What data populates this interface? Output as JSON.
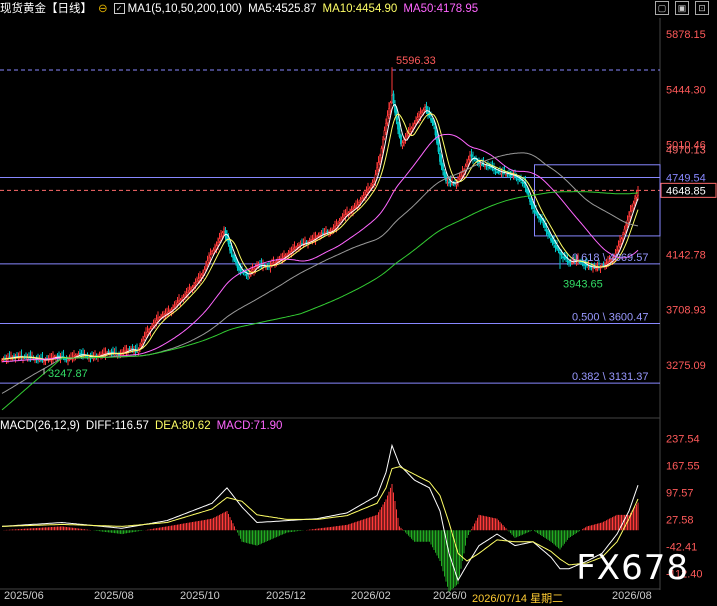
{
  "header": {
    "symbol": "现货黄金",
    "period": "【日线】",
    "icon": "circle-minus-icon",
    "ma_title": "MA1(5,10,50,200,100)",
    "ma5": "MA5:4525.87",
    "ma10": "MA10:4454.90",
    "ma50": "MA50:4178.95"
  },
  "window_buttons": [
    "▢",
    "▣",
    "⊡"
  ],
  "colors": {
    "background": "#000000",
    "up_candle": "#ff3a3a",
    "down_candle": "#00c8c8",
    "ma5": "#ffffff",
    "ma10": "#ffff66",
    "ma50": "#ff66ff",
    "ma100": "#999999",
    "ma200": "#33cc33",
    "grid": "#7a7aff",
    "current_price": "#ff6b6b",
    "macd_label": "#ff66ff"
  },
  "chart_data": [
    {
      "type": "candlestick",
      "title": "现货黄金",
      "yticks": [
        "5878.15",
        "5444.30",
        "5010.46",
        "4970.13",
        "4749.54",
        "4648.85",
        "4142.78",
        "3708.93",
        "3275.09"
      ],
      "ylim": [
        2880,
        5990
      ],
      "xlabels": [
        "2025/06",
        "2025/08",
        "2025/10",
        "2025/12",
        "2026/02",
        "2026/0",
        "2026/07/14 星期二",
        "2026/08"
      ],
      "annotations": {
        "high": "5596.33",
        "low_left": "3247.87",
        "low_recent": "3943.65",
        "fib_0618": "0.618 \\ 4069.57",
        "fib_0500": "0.500 \\ 3600.47",
        "fib_0382": "0.382 \\ 3131.37",
        "current_price": "4648.85"
      },
      "close_anchors": [
        [
          0,
          3320
        ],
        [
          10,
          3340
        ],
        [
          20,
          3330
        ],
        [
          28,
          3310
        ],
        [
          36,
          3340
        ],
        [
          44,
          3320
        ],
        [
          52,
          3360
        ],
        [
          60,
          3330
        ],
        [
          70,
          3370
        ],
        [
          78,
          3360
        ],
        [
          86,
          3400
        ],
        [
          90,
          3380
        ],
        [
          96,
          3520
        ],
        [
          104,
          3640
        ],
        [
          112,
          3700
        ],
        [
          120,
          3800
        ],
        [
          128,
          3900
        ],
        [
          134,
          4000
        ],
        [
          138,
          4120
        ],
        [
          144,
          4240
        ],
        [
          148,
          4340
        ],
        [
          152,
          4180
        ],
        [
          158,
          4020
        ],
        [
          164,
          3980
        ],
        [
          170,
          4060
        ],
        [
          178,
          4050
        ],
        [
          186,
          4110
        ],
        [
          192,
          4160
        ],
        [
          198,
          4220
        ],
        [
          204,
          4240
        ],
        [
          212,
          4300
        ],
        [
          220,
          4330
        ],
        [
          228,
          4450
        ],
        [
          236,
          4520
        ],
        [
          242,
          4620
        ],
        [
          248,
          4720
        ],
        [
          252,
          4920
        ],
        [
          256,
          5180
        ],
        [
          260,
          5396
        ],
        [
          263,
          5200
        ],
        [
          266,
          5010
        ],
        [
          270,
          5080
        ],
        [
          276,
          5200
        ],
        [
          282,
          5300
        ],
        [
          288,
          5160
        ],
        [
          292,
          4880
        ],
        [
          296,
          4720
        ],
        [
          302,
          4700
        ],
        [
          306,
          4760
        ],
        [
          312,
          4920
        ],
        [
          318,
          4860
        ],
        [
          324,
          4840
        ],
        [
          330,
          4800
        ],
        [
          336,
          4780
        ],
        [
          342,
          4760
        ],
        [
          348,
          4700
        ],
        [
          354,
          4500
        ],
        [
          360,
          4400
        ],
        [
          366,
          4260
        ],
        [
          372,
          4150
        ],
        [
          378,
          4080
        ],
        [
          384,
          4100
        ],
        [
          390,
          4050
        ],
        [
          396,
          4040
        ],
        [
          402,
          4060
        ],
        [
          408,
          4120
        ],
        [
          414,
          4300
        ],
        [
          420,
          4520
        ],
        [
          424,
          4648
        ]
      ],
      "high_index": 260,
      "low_index": 372
    },
    {
      "type": "macd",
      "title": "MACD(26,12,9)",
      "diff_label": "DIFF:116.57",
      "dea_label": "DEA:80.62",
      "macd_label": "MACD:71.90",
      "yticks": [
        "237.54",
        "167.55",
        "97.57",
        "27.58",
        "-42.41",
        "-112.40"
      ],
      "ylim": [
        -150,
        255
      ],
      "diff_anchors": [
        [
          0,
          10
        ],
        [
          40,
          20
        ],
        [
          80,
          5
        ],
        [
          110,
          25
        ],
        [
          140,
          70
        ],
        [
          150,
          110
        ],
        [
          160,
          60
        ],
        [
          170,
          20
        ],
        [
          190,
          25
        ],
        [
          210,
          30
        ],
        [
          230,
          45
        ],
        [
          250,
          90
        ],
        [
          256,
          150
        ],
        [
          260,
          220
        ],
        [
          265,
          170
        ],
        [
          275,
          130
        ],
        [
          285,
          110
        ],
        [
          292,
          50
        ],
        [
          298,
          -60
        ],
        [
          304,
          -130
        ],
        [
          310,
          -90
        ],
        [
          318,
          -40
        ],
        [
          330,
          -10
        ],
        [
          342,
          -40
        ],
        [
          354,
          -30
        ],
        [
          366,
          -70
        ],
        [
          372,
          -100
        ],
        [
          378,
          -100
        ],
        [
          390,
          -80
        ],
        [
          400,
          -60
        ],
        [
          410,
          -10
        ],
        [
          418,
          50
        ],
        [
          424,
          117
        ]
      ],
      "dea_anchors": [
        [
          0,
          10
        ],
        [
          40,
          15
        ],
        [
          80,
          10
        ],
        [
          110,
          20
        ],
        [
          140,
          55
        ],
        [
          150,
          85
        ],
        [
          160,
          75
        ],
        [
          170,
          40
        ],
        [
          190,
          28
        ],
        [
          210,
          28
        ],
        [
          230,
          38
        ],
        [
          250,
          70
        ],
        [
          256,
          110
        ],
        [
          260,
          160
        ],
        [
          265,
          165
        ],
        [
          275,
          145
        ],
        [
          285,
          125
        ],
        [
          292,
          90
        ],
        [
          298,
          20
        ],
        [
          304,
          -60
        ],
        [
          310,
          -80
        ],
        [
          318,
          -60
        ],
        [
          330,
          -25
        ],
        [
          342,
          -30
        ],
        [
          354,
          -30
        ],
        [
          366,
          -55
        ],
        [
          372,
          -75
        ],
        [
          378,
          -90
        ],
        [
          390,
          -85
        ],
        [
          400,
          -70
        ],
        [
          410,
          -30
        ],
        [
          418,
          30
        ],
        [
          424,
          81
        ]
      ]
    }
  ],
  "watermark": "FX678"
}
